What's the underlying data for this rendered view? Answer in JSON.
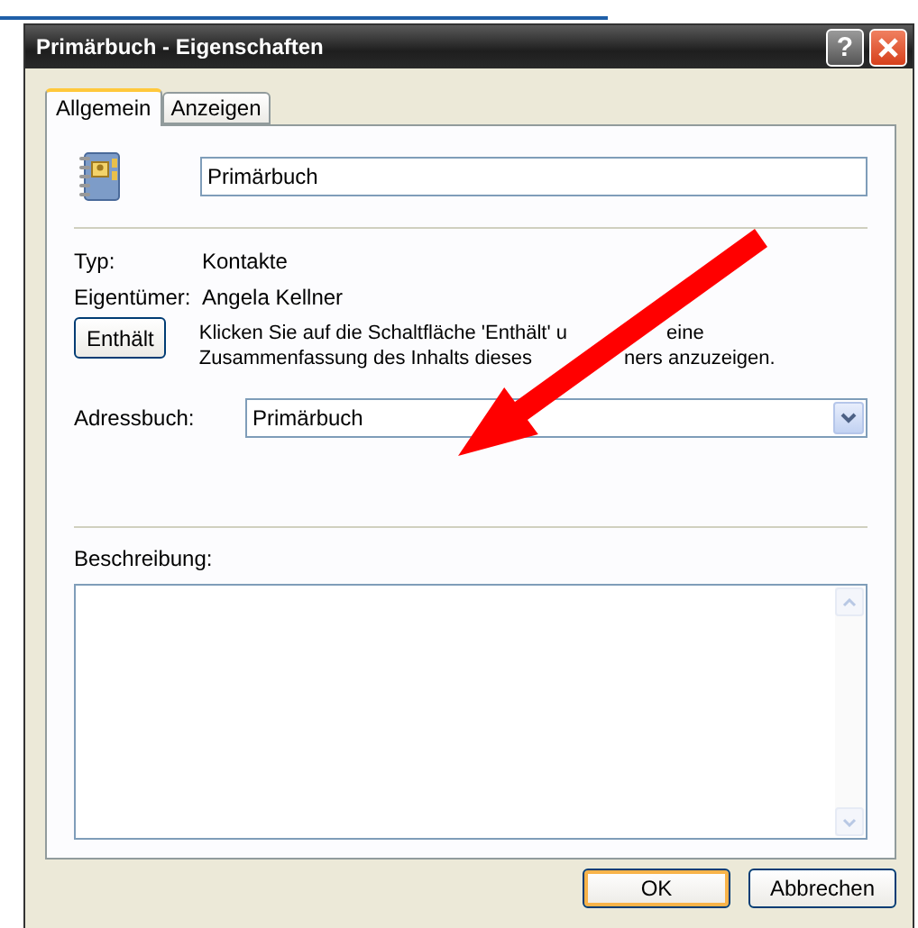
{
  "window": {
    "title": "Primärbuch - Eigenschaften",
    "help_button": "?"
  },
  "tabs": [
    {
      "label": "Allgemein",
      "selected": true
    },
    {
      "label": "Anzeigen",
      "selected": false
    }
  ],
  "name_field": {
    "value": "Primärbuch"
  },
  "properties": [
    {
      "label": "Typ:",
      "value": "Kontakte"
    },
    {
      "label": "Eigentümer:",
      "value": "Angela Kellner"
    }
  ],
  "contents_button": {
    "label": "Enthält"
  },
  "contents_hint": [
    [
      "Klicken Sie auf die Schaltfläche 'Enthält' u",
      "eine"
    ],
    [
      "Zusammenfassung des Inhalts dieses",
      "ners anzuzeigen."
    ]
  ],
  "address_book": {
    "label": "Adressbuch:",
    "value": "Primärbuch"
  },
  "description": {
    "label": "Beschreibung:"
  },
  "buttons": [
    {
      "label": "OK",
      "default": true
    },
    {
      "label": "Abbrechen",
      "default": false
    }
  ]
}
